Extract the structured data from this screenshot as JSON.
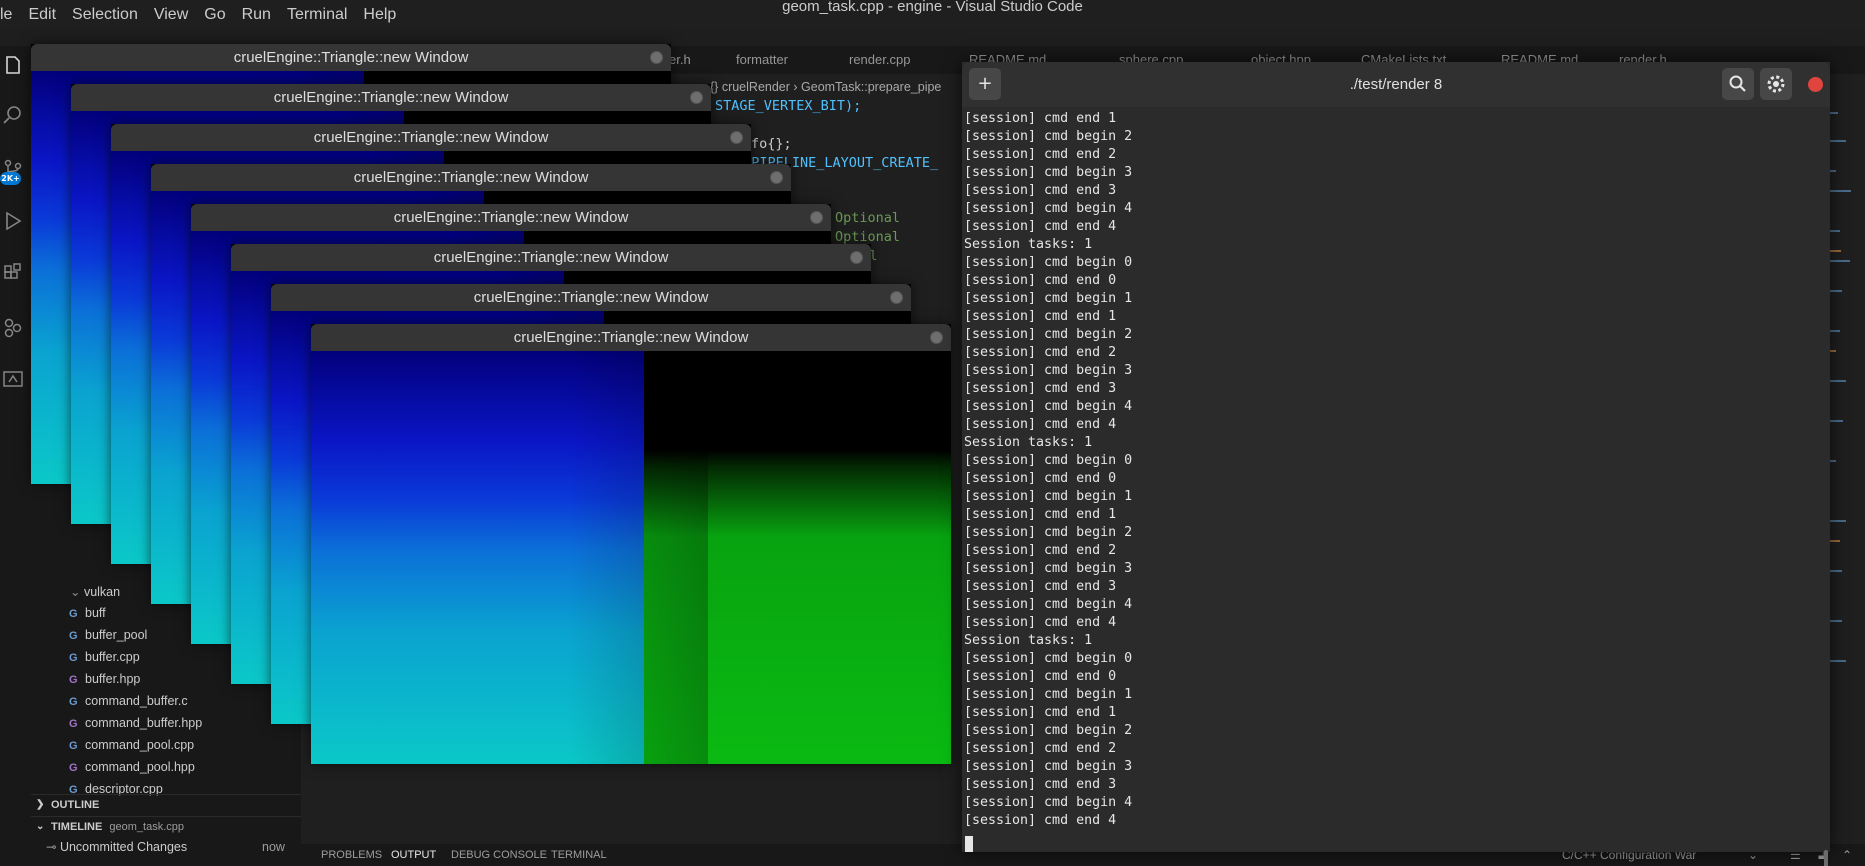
{
  "window_title": "geom_task.cpp - engine - Visual Studio Code",
  "menu": [
    "le",
    "Edit",
    "Selection",
    "View",
    "Go",
    "Run",
    "Terminal",
    "Help"
  ],
  "activity_badge": "2K+",
  "editor_tabs": [
    "er.h",
    "formatter",
    "render.cpp",
    "README.md",
    "sphere.cpp",
    "object.hpp",
    "CMakeLists.txt",
    "README.md",
    "render.h"
  ],
  "breadcrumbs": "{} cruelRender  ›  GeomTask::prepare_pipe",
  "code_lines": [
    {
      "text": "STAGE_VERTEX_BIT);",
      "color": "#4fc1ff"
    },
    {
      "text": "fo{};",
      "color": "#cccccc"
    },
    {
      "text": "E_PIPELINE_LAYOUT_CREATE_",
      "color": "#4fc1ff"
    },
    {
      "text": "Optional",
      "color": "#6a9955"
    },
    {
      "text": "Optional",
      "color": "#6a9955"
    },
    {
      "text": "onal",
      "color": "#6a9955"
    }
  ],
  "sidebar": {
    "folder_label": "vulkan",
    "files": [
      {
        "name": "buff",
        "kind": "c"
      },
      {
        "name": "buffer_pool",
        "kind": "c"
      },
      {
        "name": "buffer.cpp",
        "kind": "c"
      },
      {
        "name": "buffer.hpp",
        "kind": "h"
      },
      {
        "name": "command_buffer.c",
        "kind": "c"
      },
      {
        "name": "command_buffer.hpp",
        "kind": "h"
      },
      {
        "name": "command_pool.cpp",
        "kind": "c"
      },
      {
        "name": "command_pool.hpp",
        "kind": "h"
      },
      {
        "name": "descriptor.cpp",
        "kind": "c"
      }
    ],
    "outline_label": "OUTLINE",
    "timeline_label": "TIMELINE",
    "timeline_file": "geom_task.cpp",
    "timeline_entry": "Uncommitted Changes",
    "timeline_time": "now"
  },
  "panel_tabs": [
    "PROBLEMS",
    "OUTPUT",
    "DEBUG CONSOLE",
    "TERMINAL"
  ],
  "status_right": "C/C++ Configuration War",
  "render_windows": [
    {
      "title": "cruelEngine::Triangle::new Window"
    },
    {
      "title": "cruelEngine::Triangle::new Window"
    },
    {
      "title": "cruelEngine::Triangle::new Window"
    },
    {
      "title": "cruelEngine::Triangle::new Window"
    },
    {
      "title": "cruelEngine::Triangle::new Window"
    },
    {
      "title": "cruelEngine::Triangle::new Window"
    },
    {
      "title": "cruelEngine::Triangle::new Window"
    },
    {
      "title": "cruelEngine::Triangle::new Window"
    }
  ],
  "terminal": {
    "title": "./test/render 8",
    "new_tab_icon": "plus-icon",
    "search_icon": "search-icon",
    "menu_icon": "gear-icon",
    "lines": [
      "[session] cmd end 1",
      "[session] cmd begin 2",
      "[session] cmd end 2",
      "[session] cmd begin 3",
      "[session] cmd end 3",
      "[session] cmd begin 4",
      "[session] cmd end 4",
      "Session tasks: 1",
      "[session] cmd begin 0",
      "[session] cmd end 0",
      "[session] cmd begin 1",
      "[session] cmd end 1",
      "[session] cmd begin 2",
      "[session] cmd end 2",
      "[session] cmd begin 3",
      "[session] cmd end 3",
      "[session] cmd begin 4",
      "[session] cmd end 4",
      "Session tasks: 1",
      "[session] cmd begin 0",
      "[session] cmd end 0",
      "[session] cmd begin 1",
      "[session] cmd end 1",
      "[session] cmd begin 2",
      "[session] cmd end 2",
      "[session] cmd begin 3",
      "[session] cmd end 3",
      "[session] cmd begin 4",
      "[session] cmd end 4",
      "Session tasks: 1",
      "[session] cmd begin 0",
      "[session] cmd end 0",
      "[session] cmd begin 1",
      "[session] cmd end 1",
      "[session] cmd begin 2",
      "[session] cmd end 2",
      "[session] cmd begin 3",
      "[session] cmd end 3",
      "[session] cmd begin 4",
      "[session] cmd end 4"
    ]
  },
  "colors": {
    "accent": "#0078d4",
    "terminal_close": "#e0443e",
    "render_blue": "#0a16c6",
    "render_green": "#0aba12"
  }
}
